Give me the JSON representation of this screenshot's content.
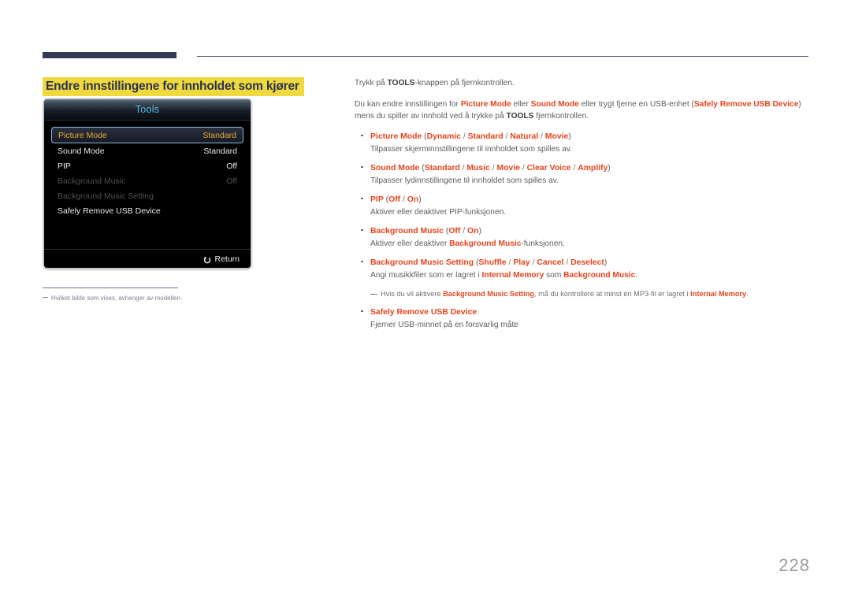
{
  "page": {
    "number": "228",
    "section_title": "Endre innstillingene for innholdet som kjører"
  },
  "tools_panel": {
    "title": "Tools",
    "rows": [
      {
        "label": "Picture Mode",
        "value": "Standard",
        "state": "selected"
      },
      {
        "label": "Sound Mode",
        "value": "Standard",
        "state": "normal"
      },
      {
        "label": "PIP",
        "value": "Off",
        "state": "normal"
      },
      {
        "label": "Background Music",
        "value": "Off",
        "state": "disabled"
      },
      {
        "label": "Background Music Setting",
        "value": "",
        "state": "disabled"
      },
      {
        "label": "Safely Remove USB Device",
        "value": "",
        "state": "normal"
      }
    ],
    "footer": {
      "return_label": "Return",
      "return_icon": "return-arrow-icon"
    }
  },
  "left_note": {
    "text": "Hvilket bilde som vises, avhenger av modellen."
  },
  "body": {
    "paragraph_1": {
      "pre": "Trykk på ",
      "bold": "TOOLS",
      "post": "-knappen på fjernkontrollen."
    },
    "paragraph_2": {
      "t1": "Du kan endre innstillingen for ",
      "r1": "Picture Mode",
      "t2": " eller ",
      "r2": "Sound Mode",
      "t3": " eller trygt fjerne en USB-enhet (",
      "r3": "Safely Remove USB Device",
      "t4": ") mens du spiller av innhold ved å trykke på ",
      "b1": "TOOLS",
      "t5": " fjernkontrollen."
    },
    "bullets": [
      {
        "name": "Picture Mode",
        "options": [
          "Dynamic",
          "Standard",
          "Natural",
          "Movie"
        ],
        "desc": "Tilpasser skjerminnstillingene til innholdet som spilles av."
      },
      {
        "name": "Sound Mode",
        "options": [
          "Standard",
          "Music",
          "Movie",
          "Clear Voice",
          "Amplify"
        ],
        "desc": "Tilpasser lydinnstillingene til innholdet som spilles av."
      },
      {
        "name": "PIP",
        "options": [
          "Off",
          "On"
        ],
        "desc": "Aktiver eller deaktiver PIP-funksjonen."
      },
      {
        "name": "Background Music",
        "options": [
          "Off",
          "On"
        ],
        "desc_pre": "Aktiver eller deaktiver ",
        "desc_red": "Background Music",
        "desc_post": "-funksjonen."
      },
      {
        "name": "Background Music Setting",
        "options": [
          "Shuffle",
          "Play",
          "Cancel",
          "Deselect"
        ],
        "desc_pre": "Angi musikkfiler som er lagret i ",
        "desc_red1": "Internal Memory",
        "desc_mid": " som ",
        "desc_red2": "Background Music",
        "desc_post": "."
      },
      {
        "name": "Safely Remove USB Device",
        "options": [],
        "desc": "Fjerner USB-minnet på en forsvarlig måte"
      }
    ],
    "subnote": {
      "t1": "Hvis du vil aktivere ",
      "r1": "Background Music Setting",
      "t2": ", må du kontrollere at minst én MP3-fil er lagret i ",
      "r2": "Internal Memory",
      "t3": "."
    }
  },
  "colors": {
    "accent_red": "#e8441c",
    "highlight_yellow": "#efd93f",
    "header_navy": "#333a56",
    "osd_blue": "#5fb9e8",
    "osd_gold": "#f0a92b"
  }
}
